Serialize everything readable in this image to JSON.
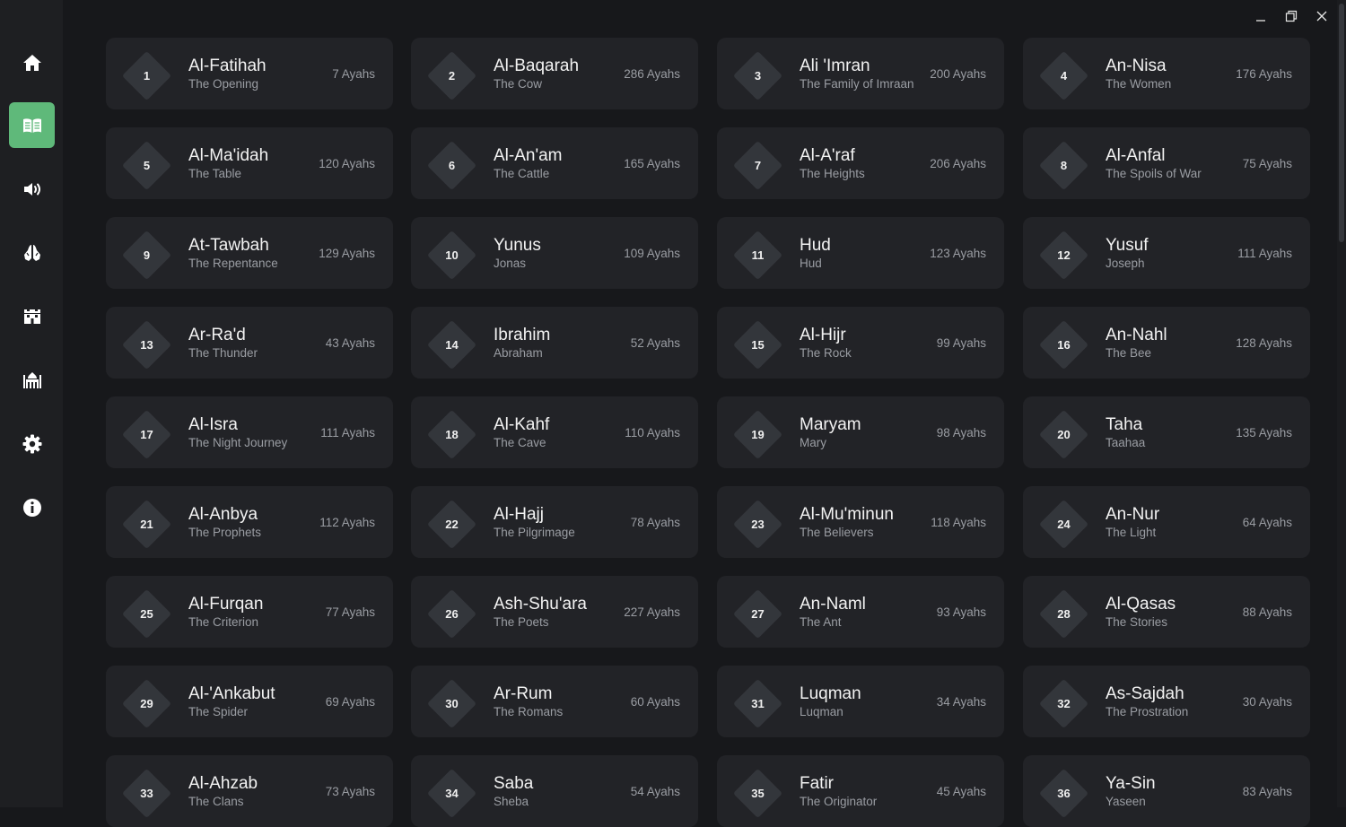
{
  "sidebar": {
    "items": [
      {
        "icon": "home-icon",
        "active": false
      },
      {
        "icon": "quran-book-icon",
        "active": true
      },
      {
        "icon": "audio-speaker-icon",
        "active": false
      },
      {
        "icon": "prayer-hands-icon",
        "active": false
      },
      {
        "icon": "kaaba-icon",
        "active": false
      },
      {
        "icon": "mosque-icon",
        "active": false
      },
      {
        "icon": "gear-icon",
        "active": false
      },
      {
        "icon": "info-icon",
        "active": false
      }
    ],
    "accent_color": "#5fb97a"
  },
  "window_controls": [
    "minimize-icon",
    "restore-icon",
    "close-icon"
  ],
  "surahs": [
    {
      "number": "1",
      "name": "Al-Fatihah",
      "translation": "The Opening",
      "ayahs": "7 Ayahs"
    },
    {
      "number": "2",
      "name": "Al-Baqarah",
      "translation": "The Cow",
      "ayahs": "286 Ayahs"
    },
    {
      "number": "3",
      "name": "Ali 'Imran",
      "translation": "The Family of Imraan",
      "ayahs": "200 Ayahs"
    },
    {
      "number": "4",
      "name": "An-Nisa",
      "translation": "The Women",
      "ayahs": "176 Ayahs"
    },
    {
      "number": "5",
      "name": "Al-Ma'idah",
      "translation": "The Table",
      "ayahs": "120 Ayahs"
    },
    {
      "number": "6",
      "name": "Al-An'am",
      "translation": "The Cattle",
      "ayahs": "165 Ayahs"
    },
    {
      "number": "7",
      "name": "Al-A'raf",
      "translation": "The Heights",
      "ayahs": "206 Ayahs"
    },
    {
      "number": "8",
      "name": "Al-Anfal",
      "translation": "The Spoils of War",
      "ayahs": "75 Ayahs"
    },
    {
      "number": "9",
      "name": "At-Tawbah",
      "translation": "The Repentance",
      "ayahs": "129 Ayahs"
    },
    {
      "number": "10",
      "name": "Yunus",
      "translation": "Jonas",
      "ayahs": "109 Ayahs"
    },
    {
      "number": "11",
      "name": "Hud",
      "translation": "Hud",
      "ayahs": "123 Ayahs"
    },
    {
      "number": "12",
      "name": "Yusuf",
      "translation": "Joseph",
      "ayahs": "111 Ayahs"
    },
    {
      "number": "13",
      "name": "Ar-Ra'd",
      "translation": "The Thunder",
      "ayahs": "43 Ayahs"
    },
    {
      "number": "14",
      "name": "Ibrahim",
      "translation": "Abraham",
      "ayahs": "52 Ayahs"
    },
    {
      "number": "15",
      "name": "Al-Hijr",
      "translation": "The Rock",
      "ayahs": "99 Ayahs"
    },
    {
      "number": "16",
      "name": "An-Nahl",
      "translation": "The Bee",
      "ayahs": "128 Ayahs"
    },
    {
      "number": "17",
      "name": "Al-Isra",
      "translation": "The Night Journey",
      "ayahs": "111 Ayahs"
    },
    {
      "number": "18",
      "name": "Al-Kahf",
      "translation": "The Cave",
      "ayahs": "110 Ayahs"
    },
    {
      "number": "19",
      "name": "Maryam",
      "translation": "Mary",
      "ayahs": "98 Ayahs"
    },
    {
      "number": "20",
      "name": "Taha",
      "translation": "Taahaa",
      "ayahs": "135 Ayahs"
    },
    {
      "number": "21",
      "name": "Al-Anbya",
      "translation": "The Prophets",
      "ayahs": "112 Ayahs"
    },
    {
      "number": "22",
      "name": "Al-Hajj",
      "translation": "The Pilgrimage",
      "ayahs": "78 Ayahs"
    },
    {
      "number": "23",
      "name": "Al-Mu'minun",
      "translation": "The Believers",
      "ayahs": "118 Ayahs"
    },
    {
      "number": "24",
      "name": "An-Nur",
      "translation": "The Light",
      "ayahs": "64 Ayahs"
    },
    {
      "number": "25",
      "name": "Al-Furqan",
      "translation": "The Criterion",
      "ayahs": "77 Ayahs"
    },
    {
      "number": "26",
      "name": "Ash-Shu'ara",
      "translation": "The Poets",
      "ayahs": "227 Ayahs"
    },
    {
      "number": "27",
      "name": "An-Naml",
      "translation": "The Ant",
      "ayahs": "93 Ayahs"
    },
    {
      "number": "28",
      "name": "Al-Qasas",
      "translation": "The Stories",
      "ayahs": "88 Ayahs"
    },
    {
      "number": "29",
      "name": "Al-'Ankabut",
      "translation": "The Spider",
      "ayahs": "69 Ayahs"
    },
    {
      "number": "30",
      "name": "Ar-Rum",
      "translation": "The Romans",
      "ayahs": "60 Ayahs"
    },
    {
      "number": "31",
      "name": "Luqman",
      "translation": "Luqman",
      "ayahs": "34 Ayahs"
    },
    {
      "number": "32",
      "name": "As-Sajdah",
      "translation": "The Prostration",
      "ayahs": "30 Ayahs"
    },
    {
      "number": "33",
      "name": "Al-Ahzab",
      "translation": "The Clans",
      "ayahs": "73 Ayahs"
    },
    {
      "number": "34",
      "name": "Saba",
      "translation": "Sheba",
      "ayahs": "54 Ayahs"
    },
    {
      "number": "35",
      "name": "Fatir",
      "translation": "The Originator",
      "ayahs": "45 Ayahs"
    },
    {
      "number": "36",
      "name": "Ya-Sin",
      "translation": "Yaseen",
      "ayahs": "83 Ayahs"
    }
  ]
}
